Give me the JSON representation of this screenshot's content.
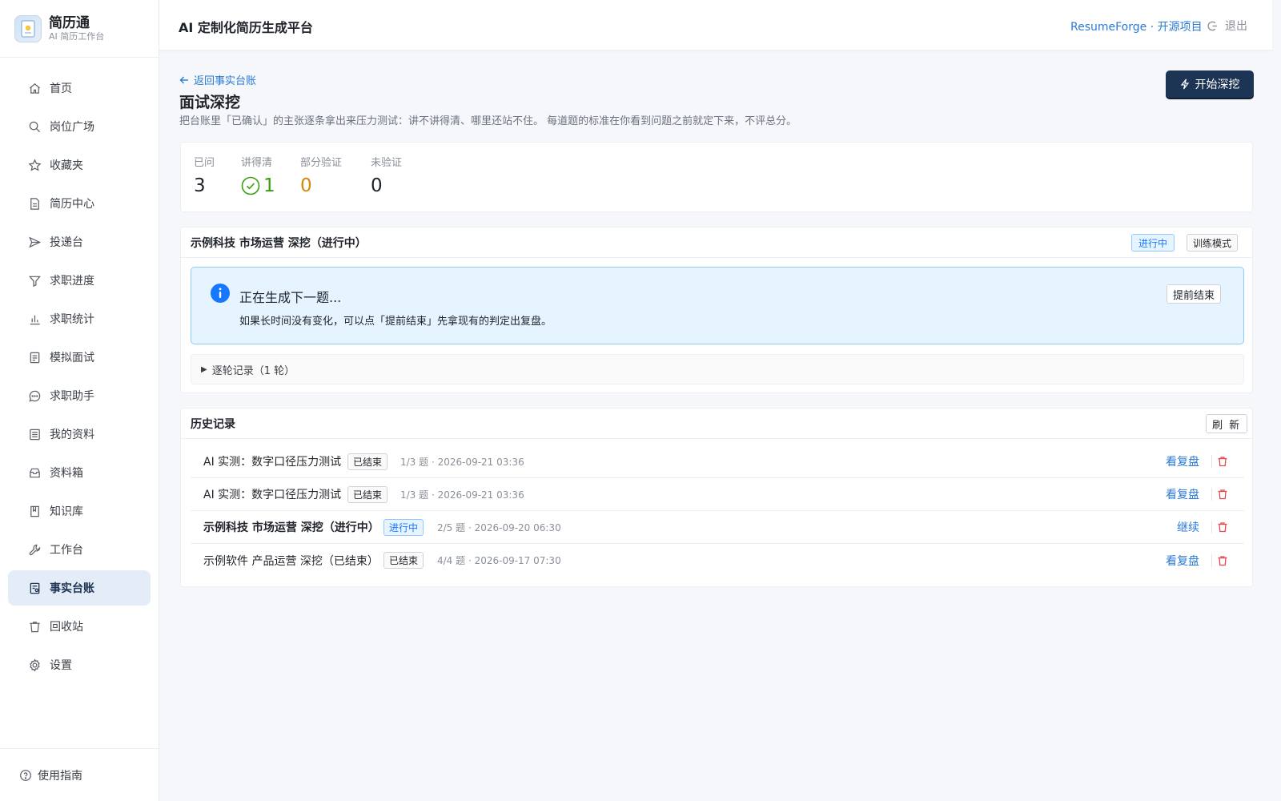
{
  "brand": {
    "title": "简历通",
    "subtitle": "AI 简历工作台"
  },
  "sidebar": {
    "items": [
      {
        "label": "首页",
        "icon": "home-icon"
      },
      {
        "label": "岗位广场",
        "icon": "search-icon"
      },
      {
        "label": "收藏夹",
        "icon": "star-icon"
      },
      {
        "label": "简历中心",
        "icon": "document-icon"
      },
      {
        "label": "投递台",
        "icon": "send-icon"
      },
      {
        "label": "求职进度",
        "icon": "funnel-icon"
      },
      {
        "label": "求职统计",
        "icon": "bar-chart-icon"
      },
      {
        "label": "模拟面试",
        "icon": "clipboard-icon"
      },
      {
        "label": "求职助手",
        "icon": "chat-icon"
      },
      {
        "label": "我的资料",
        "icon": "profile-list-icon"
      },
      {
        "label": "资料箱",
        "icon": "inbox-icon"
      },
      {
        "label": "知识库",
        "icon": "book-icon"
      },
      {
        "label": "工作台",
        "icon": "wrench-icon"
      },
      {
        "label": "事实台账",
        "icon": "ledger-icon",
        "active": true
      },
      {
        "label": "回收站",
        "icon": "trash-icon"
      },
      {
        "label": "设置",
        "icon": "gear-icon"
      }
    ],
    "footer": {
      "label": "使用指南",
      "icon": "question-icon"
    }
  },
  "header": {
    "title": "AI 定制化简历生成平台",
    "link": "ResumeForge · 开源项目",
    "logout": "退出"
  },
  "page": {
    "back_label": "返回事实台账",
    "title": "面试深挖",
    "description": "把台账里「已确认」的主张逐条拿出来压力测试：讲不讲得清、哪里还站不住。 每道题的标准在你看到问题之前就定下来，不评总分。",
    "start_button": "开始深挖"
  },
  "stats": [
    {
      "label": "已问",
      "value": "3",
      "color": "#1f2329"
    },
    {
      "label": "讲得清",
      "value": "1",
      "color": "#389e0d"
    },
    {
      "label": "部分验证",
      "value": "0",
      "color": "#d48806"
    },
    {
      "label": "未验证",
      "value": "0",
      "color": "#1f2329"
    }
  ],
  "session": {
    "title": "示例科技 市场运营 深挖（进行中）",
    "status_tag": "进行中",
    "mode_tag": "训练模式",
    "alert_title": "正在生成下一题...",
    "alert_text": "如果长时间没有变化，可以点「提前结束」先拿现有的判定出复盘。",
    "alert_button": "提前结束",
    "collapse_label": "逐轮记录（1 轮）"
  },
  "history": {
    "title": "历史记录",
    "refresh": "刷 新",
    "rows": [
      {
        "title": "AI 实测：数字口径压力测试",
        "tag": "已结束",
        "meta": "1/3 题 · 2026-09-21 03:36",
        "action": "看复盘"
      },
      {
        "title": "AI 实测：数字口径压力测试",
        "tag": "已结束",
        "meta": "1/3 题 · 2026-09-21 03:36",
        "action": "看复盘"
      },
      {
        "title": "示例科技 市场运营 深挖（进行中）",
        "tag": "进行中",
        "meta": "2/5 题 · 2026-09-20 06:30",
        "action": "继续"
      },
      {
        "title": "示例软件 产品运营 深挖（已结束）",
        "tag": "已结束",
        "meta": "4/4 题 · 2026-09-17 07:30",
        "action": "看复盘"
      }
    ]
  },
  "colors": {
    "accent": "#2a7ad6",
    "primary_button": "#1d3554",
    "active_nav_bg": "#e3ecf7",
    "info_bg": "#e6f4ff",
    "info_border": "#91caff",
    "danger": "#e5484d",
    "success": "#389e0d",
    "warning": "#d48806"
  }
}
